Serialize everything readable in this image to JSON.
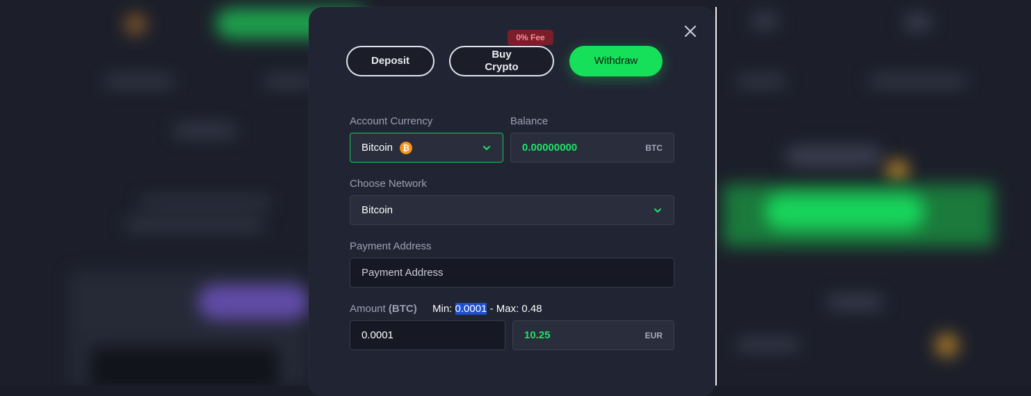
{
  "tabs": {
    "deposit": "Deposit",
    "buy_crypto_line1": "Buy",
    "buy_crypto_line2": "Crypto",
    "withdraw": "Withdraw",
    "fee_badge": "0% Fee"
  },
  "form": {
    "account_currency_label": "Account Currency",
    "account_currency_value": "Bitcoin",
    "balance_label": "Balance",
    "balance_value": "0.00000000",
    "balance_unit": "BTC",
    "network_label": "Choose Network",
    "network_value": "Bitcoin",
    "payment_address_label": "Payment Address",
    "payment_address_placeholder": "Payment Address",
    "amount_label": "Amount",
    "amount_unit_label": "(BTC)",
    "min_label": "Min:",
    "min_value": "0.0001",
    "max_text": "- Max: 0.48",
    "amount_value": "0.0001",
    "fiat_value": "10.25",
    "fiat_unit": "EUR"
  },
  "icons": {
    "coin_symbol": "₿"
  },
  "colors": {
    "accent_green": "#16e05a",
    "modal_bg": "#212533",
    "fee_badge_bg": "#7a1f2a"
  }
}
